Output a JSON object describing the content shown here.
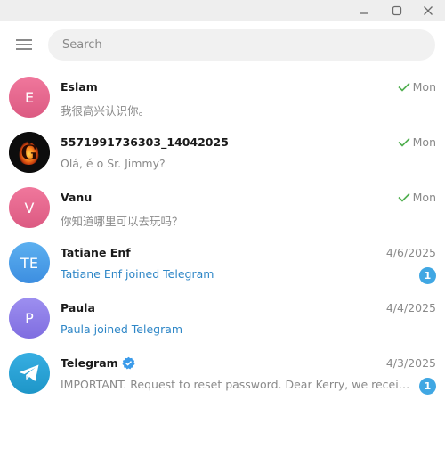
{
  "window_controls": {
    "minimize_icon": "minimize-icon",
    "maximize_icon": "maximize-icon",
    "close_icon": "close-icon"
  },
  "topbar": {
    "menu_icon": "hamburger-menu-icon",
    "search_placeholder": "Search"
  },
  "colors": {
    "accent": "#40a7e3",
    "link_blue": "#2f87c7",
    "check_green": "#4fae4e",
    "muted_text": "#8a8a8a",
    "titlebar": "#eeeeee"
  },
  "chats": [
    {
      "avatar_initials": "E",
      "avatar_color": "#e4608b",
      "name": "Eslam",
      "time": "Mon",
      "read": true,
      "preview": "我很高兴认识你。",
      "preview_type": "message",
      "unread": null
    },
    {
      "avatar_initials": "G",
      "avatar_color": "#0d0d0d",
      "avatar_image": "flaming-g-logo",
      "name": "5571991736303_14042025",
      "time": "Mon",
      "read": true,
      "preview": "Olá, é o Sr. Jimmy?",
      "preview_type": "message",
      "unread": null
    },
    {
      "avatar_initials": "V",
      "avatar_color": "#e4608b",
      "name": "Vanu",
      "time": "Mon",
      "read": true,
      "preview": "你知道哪里可以去玩吗？",
      "preview_type": "message",
      "unread": null
    },
    {
      "avatar_initials": "TE",
      "avatar_color": "#4a9ae6",
      "name": "Tatiane Enf",
      "time": "4/6/2025",
      "read": false,
      "preview": "Tatiane Enf joined Telegram",
      "preview_type": "service",
      "unread": "1"
    },
    {
      "avatar_initials": "P",
      "avatar_color": "#8f7fe8",
      "name": "Paula",
      "time": "4/4/2025",
      "read": false,
      "preview": "Paula joined Telegram",
      "preview_type": "service",
      "unread": null
    },
    {
      "avatar_initials": "",
      "avatar_color": "#2a9fd8",
      "avatar_icon": "telegram-paper-plane-icon",
      "name": "Telegram",
      "verified": true,
      "time": "4/3/2025",
      "read": false,
      "preview": "IMPORTANT. Request to reset password.  Dear Kerry, we received...",
      "preview_type": "message",
      "unread": "1"
    }
  ]
}
